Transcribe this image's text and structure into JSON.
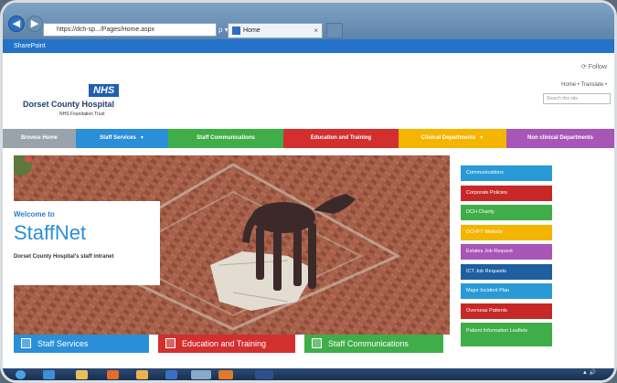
{
  "browser": {
    "address": "https://dch-sp.../Pages/Home.aspx",
    "address_glyphs": "ρ ▾ c",
    "tab_title": "Home",
    "tab_close": "×"
  },
  "suite_bar": {
    "label": "SharePoint"
  },
  "header": {
    "nhs_logo": "NHS",
    "hospital_name": "Dorset County Hospital",
    "trust": "NHS Foundation Trust",
    "follow": "⟳ Follow",
    "links": "Home  •  Translate  •",
    "search_placeholder": "Search this site"
  },
  "nav": {
    "items": [
      {
        "label": "Browse Home",
        "color": "#9aa3ab"
      },
      {
        "label": "Staff Services",
        "color": "#2a8fd8",
        "arrow": "▼"
      },
      {
        "label": "Staff Communications",
        "color": "#3fae49"
      },
      {
        "label": "Education and Training",
        "color": "#d32f2f"
      },
      {
        "label": "Clinical Departments",
        "color": "#f4b400",
        "arrow": "▼"
      },
      {
        "label": "Non clinical Departments",
        "color": "#a855b8"
      }
    ]
  },
  "hero": {
    "welcome_to": "Welcome to",
    "title": "StaffNet",
    "subtitle": "Dorset County Hospital's staff intranet"
  },
  "quick_links": [
    {
      "label": "Communications",
      "color": "#2a9ad6"
    },
    {
      "label": "Corporate Policies",
      "color": "#c62828"
    },
    {
      "label": "DCH Charity",
      "color": "#3fae49"
    },
    {
      "label": "DCHFT Website",
      "color": "#f4b400"
    },
    {
      "label": "Estates Job Request",
      "color": "#a855b8"
    },
    {
      "label": "ICT Job Requests",
      "color": "#1f5fa0"
    },
    {
      "label": "Major Incident Plan",
      "color": "#2a9ad6"
    },
    {
      "label": "Overseas Patients",
      "color": "#c62828"
    },
    {
      "label": "Patient Information Leaflets",
      "color": "#3fae49"
    }
  ],
  "sections": [
    {
      "label": "Staff Services",
      "color": "#2a8fd8"
    },
    {
      "label": "Education and Training",
      "color": "#d32f2f"
    },
    {
      "label": "Staff Communications",
      "color": "#3fae49"
    }
  ],
  "taskbar": {
    "clock": "▲ 🔊"
  }
}
